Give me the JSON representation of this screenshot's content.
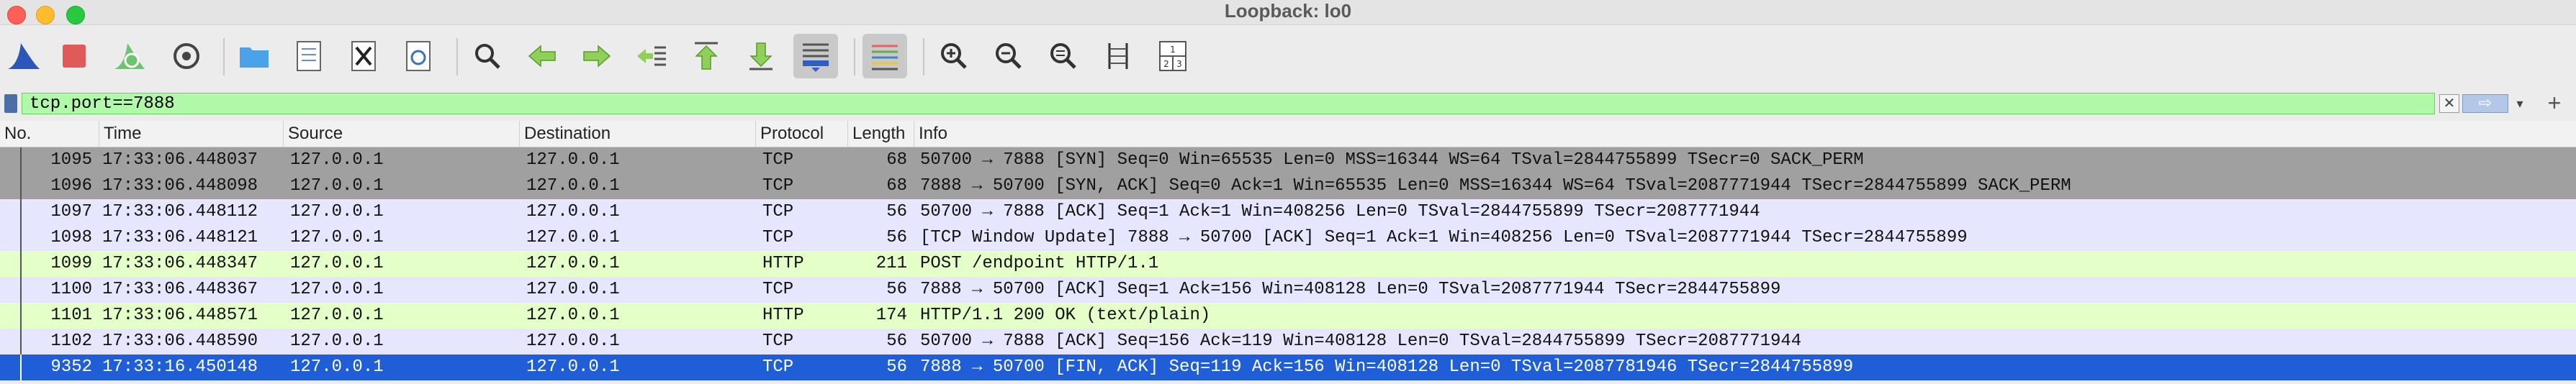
{
  "window": {
    "title": "Loopback: lo0"
  },
  "toolbar": {
    "buttons": [
      {
        "name": "start-capture",
        "icon": "shark-fin-icon"
      },
      {
        "name": "stop-capture",
        "icon": "stop-square-icon"
      },
      {
        "name": "restart-capture",
        "icon": "restart-fin-icon"
      },
      {
        "name": "capture-options",
        "icon": "gear-icon"
      },
      {
        "name": "open-file",
        "icon": "folder-icon"
      },
      {
        "name": "save-file",
        "icon": "document-icon"
      },
      {
        "name": "close-file",
        "icon": "close-file-icon"
      },
      {
        "name": "reload-file",
        "icon": "reload-icon"
      },
      {
        "name": "find-packet",
        "icon": "search-icon"
      },
      {
        "name": "go-back",
        "icon": "arrow-left-icon"
      },
      {
        "name": "go-forward",
        "icon": "arrow-right-icon"
      },
      {
        "name": "go-to-packet",
        "icon": "go-to-packet-icon"
      },
      {
        "name": "go-first",
        "icon": "go-first-icon"
      },
      {
        "name": "go-last",
        "icon": "go-last-icon"
      },
      {
        "name": "autoscroll",
        "icon": "autoscroll-icon"
      },
      {
        "name": "colorize",
        "icon": "colorize-icon"
      },
      {
        "name": "zoom-in",
        "icon": "zoom-in-icon"
      },
      {
        "name": "zoom-out",
        "icon": "zoom-out-icon"
      },
      {
        "name": "zoom-reset",
        "icon": "zoom-reset-icon"
      },
      {
        "name": "resize-columns",
        "icon": "resize-columns-icon"
      },
      {
        "name": "layout",
        "icon": "layout-icon"
      }
    ]
  },
  "filter": {
    "value": "tcp.port==7888",
    "clear_label": "✕",
    "apply_label": "⇨",
    "dropdown_label": "▾",
    "add_label": "+"
  },
  "columns": {
    "no": "No.",
    "time": "Time",
    "source": "Source",
    "destination": "Destination",
    "protocol": "Protocol",
    "length": "Length",
    "info": "Info"
  },
  "packets": [
    {
      "no": "1095",
      "time": "17:33:06.448037",
      "source": "127.0.0.1",
      "destination": "127.0.0.1",
      "protocol": "TCP",
      "length": "68",
      "info": "50700 → 7888 [SYN] Seq=0 Win=65535 Len=0 MSS=16344 WS=64 TSval=2844755899 TSecr=0 SACK_PERM",
      "style": "tcp-syn"
    },
    {
      "no": "1096",
      "time": "17:33:06.448098",
      "source": "127.0.0.1",
      "destination": "127.0.0.1",
      "protocol": "TCP",
      "length": "68",
      "info": "7888 → 50700 [SYN, ACK] Seq=0 Ack=1 Win=65535 Len=0 MSS=16344 WS=64 TSval=2087771944 TSecr=2844755899 SACK_PERM",
      "style": "tcp-syn"
    },
    {
      "no": "1097",
      "time": "17:33:06.448112",
      "source": "127.0.0.1",
      "destination": "127.0.0.1",
      "protocol": "TCP",
      "length": "56",
      "info": "50700 → 7888 [ACK] Seq=1 Ack=1 Win=408256 Len=0 TSval=2844755899 TSecr=2087771944",
      "style": "tcp"
    },
    {
      "no": "1098",
      "time": "17:33:06.448121",
      "source": "127.0.0.1",
      "destination": "127.0.0.1",
      "protocol": "TCP",
      "length": "56",
      "info": "[TCP Window Update] 7888 → 50700 [ACK] Seq=1 Ack=1 Win=408256 Len=0 TSval=2087771944 TSecr=2844755899",
      "style": "tcp"
    },
    {
      "no": "1099",
      "time": "17:33:06.448347",
      "source": "127.0.0.1",
      "destination": "127.0.0.1",
      "protocol": "HTTP",
      "length": "211",
      "info": "POST /endpoint HTTP/1.1",
      "style": "http"
    },
    {
      "no": "1100",
      "time": "17:33:06.448367",
      "source": "127.0.0.1",
      "destination": "127.0.0.1",
      "protocol": "TCP",
      "length": "56",
      "info": "7888 → 50700 [ACK] Seq=1 Ack=156 Win=408128 Len=0 TSval=2087771944 TSecr=2844755899",
      "style": "tcp"
    },
    {
      "no": "1101",
      "time": "17:33:06.448571",
      "source": "127.0.0.1",
      "destination": "127.0.0.1",
      "protocol": "HTTP",
      "length": "174",
      "info": "HTTP/1.1 200 OK  (text/plain)",
      "style": "http"
    },
    {
      "no": "1102",
      "time": "17:33:06.448590",
      "source": "127.0.0.1",
      "destination": "127.0.0.1",
      "protocol": "TCP",
      "length": "56",
      "info": "50700 → 7888 [ACK] Seq=156 Ack=119 Win=408128 Len=0 TSval=2844755899 TSecr=2087771944",
      "style": "tcp"
    },
    {
      "no": "9352",
      "time": "17:33:16.450148",
      "source": "127.0.0.1",
      "destination": "127.0.0.1",
      "protocol": "TCP",
      "length": "56",
      "info": "7888 → 50700 [FIN, ACK] Seq=119 Ack=156 Win=408128 Len=0 TSval=2087781946 TSecr=2844755899",
      "style": "selected"
    }
  ],
  "colors": {
    "tcp_syn_row": "#a0a0a0",
    "tcp_row": "#e7e6ff",
    "http_row": "#e4ffc7",
    "selected_row": "#1f5ed6",
    "filter_valid": "#aff9a8"
  }
}
